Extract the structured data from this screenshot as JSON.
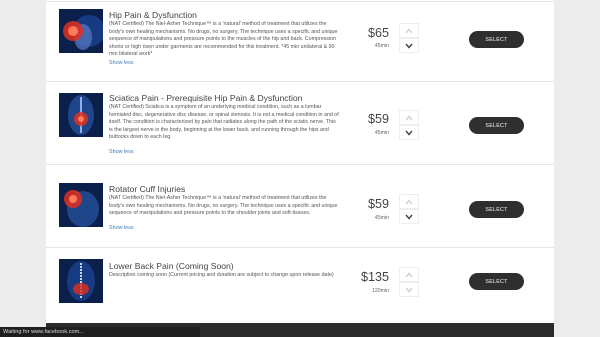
{
  "services": [
    {
      "title": "Hip Pain & Dysfunction",
      "description": "(NAT Certified) The Niel-Asher Technique™ is a 'natural' method of treatment that utilizes the body's own healing mechanisms. No drugs, no surgery. The technique uses a specific and unique sequence of manipulations and pressure points to the muscles of the hip and back. Compression shorts or high risen under garments are recommended for this treatment. *45 min unilateral & 90 min bilateral work*",
      "toggle_label": "Show less",
      "price": "$65",
      "duration": "45min",
      "select_label": "SELECT",
      "image_icon": "hip-pain-image"
    },
    {
      "title": "Sciatica Pain - Prerequisite Hip Pain & Dysfunction",
      "description": "(NAT Certified) Sciatica is a symptom of an underlying medical condition, such as a lumbar herniated disc, degenerative disc disease, or spinal stenosis. It is not a medical condition in and of itself. The condition is characterized by pain that radiates along the path of the sciatic nerve. This is the largest nerve in the body, beginning at the lower back, and running through the hips and buttocks down to each leg.",
      "toggle_label": "Show less",
      "price": "$59",
      "duration": "45min",
      "select_label": "SELECT",
      "image_icon": "sciatica-image"
    },
    {
      "title": "Rotator Cuff Injuries",
      "description": "(NAT Certified) The Niel-Asher Technique™ is a 'natural' method of treatment that utilizes the body's own healing mechanisms. No drugs, no surgery. The technique uses a specific and unique sequence of manipulations and pressure points to the shoulder joints and soft-tissues.",
      "toggle_label": "Show less",
      "price": "$59",
      "duration": "45min",
      "select_label": "SELECT",
      "image_icon": "rotator-cuff-image"
    },
    {
      "title": "Lower Back Pain (Coming Soon)",
      "description": "Description coming soon (Current pricing and duration are subject to change upon release date)",
      "price": "$135",
      "duration": "120min",
      "select_label": "SELECT",
      "image_icon": "lower-back-image"
    }
  ],
  "status_bar": {
    "text": "Waiting for www.facebook.com..."
  },
  "colors": {
    "button": "#2f2f2f",
    "link": "#3b7bbf",
    "thumb_bg": "#0a1f4a",
    "pain_red": "#e0301e"
  }
}
